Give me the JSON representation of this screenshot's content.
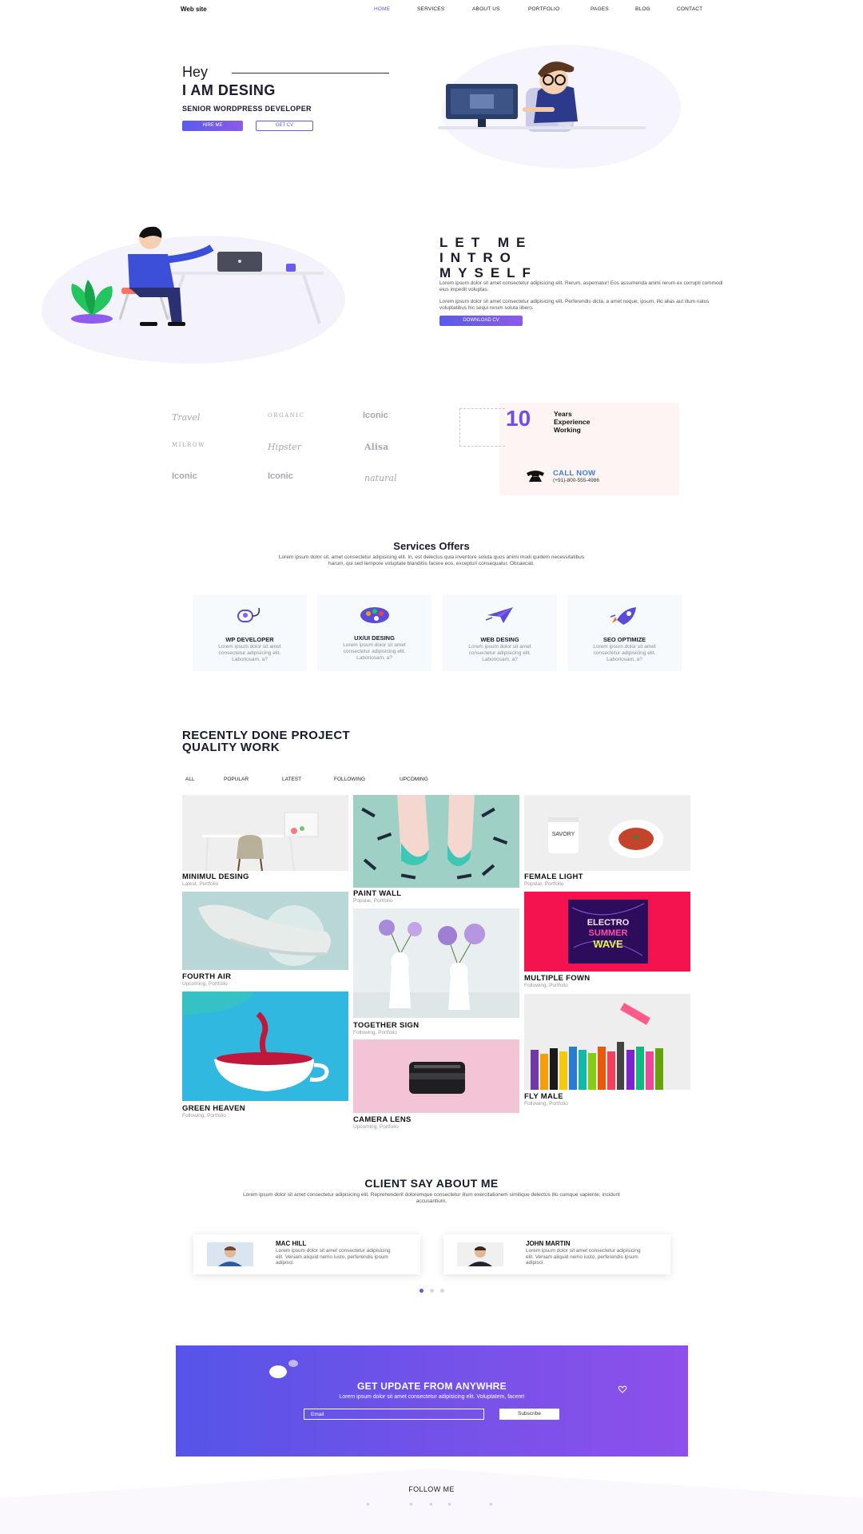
{
  "nav": {
    "logo": "Web site",
    "items": [
      "HOME",
      "SERVICES",
      "ABOUT US",
      "PORTFOLIO",
      "PAGES",
      "BLOG",
      "CONTACT"
    ]
  },
  "hero": {
    "greeting": "Hey",
    "title": "I AM DESING",
    "subtitle": "SENIOR WORDPRESS DEVELOPER",
    "hire_label": "HIRE ME",
    "cv_label": "GET CV"
  },
  "intro": {
    "title_lines": [
      "LET ME",
      "INTRO",
      "MYSELF"
    ],
    "para1": "Lorem ipsum dolor sit amet consectetur adipisicing elit. Rerum, aspernatur! Eos assumenda animi rerum ex corrupti commodi eius impedit voluptas.",
    "para2": "Lorem ipsum dolor sit amet consectetur adipisicing elit. Perferendis dicta, a amet neque, ipsum, illo alias aut illum natus voluptatibus hic sequi rerum soluta libero.",
    "download_label": "DOWNLOAD CV"
  },
  "brands": [
    "Travel",
    "ORGANIC",
    "Iconic",
    "MILROW",
    "Hipster",
    "Alisa",
    "Iconic",
    "Iconic",
    "natural"
  ],
  "experience": {
    "number": "10",
    "label_lines": [
      "Years",
      "Experience",
      "Working"
    ],
    "call_label": "CALL NOW",
    "phone": "(+91)-800-555-4986"
  },
  "services": {
    "title": "Services Offers",
    "description": "Lorem ipsum dolor sit, amet consectetur adipisicing elit. In, est delectus quia inventore soluta quos animi modi quidem necessitatibus harum, qui sed tempore voluptate blanditiis facere eos, excepturi consequatur. Obcaecati.",
    "cards": [
      {
        "name": "WP DEVELOPER",
        "desc": "Lorem ipsum dolor sit amet consectetur adipisicing elit. Laboriosam, a?",
        "icon": "mouse-icon"
      },
      {
        "name": "UX/UI DESING",
        "desc": "Lorem ipsum dolor sit amet consectetur adipisicing elit. Laboriosam, a?",
        "icon": "palette-icon"
      },
      {
        "name": "WEB DESING",
        "desc": "Lorem ipsum dolor sit amet consectetur adipisicing elit. Laboriosam, a?",
        "icon": "paper-plane-icon"
      },
      {
        "name": "SEO OPTIMIZE",
        "desc": "Lorem ipsum dolor sit amet consectetur adipisicing elit. Laboriosam, a?",
        "icon": "rocket-icon"
      }
    ]
  },
  "portfolio": {
    "heading_lines": [
      "RECENTLY DONE PROJECT",
      "QUALITY WORK"
    ],
    "filters": [
      "ALL",
      "POPULAR",
      "LATEST",
      "FOLLOWING",
      "UPCOMING"
    ],
    "tiles": [
      {
        "title": "MINIMUL DESING",
        "sub": "Latest, Portfolio"
      },
      {
        "title": "PAINT WALL",
        "sub": "Popular, Portfolio"
      },
      {
        "title": "FEMALE LIGHT",
        "sub": "Popular, Portfolio"
      },
      {
        "title": "FOURTH AIR",
        "sub": "Upcoming, Portfolio"
      },
      {
        "title": "TOGETHER SIGN",
        "sub": "Following, Portfolio"
      },
      {
        "title": "MULTIPLE FOWN",
        "sub": "Following, Portfolio"
      },
      {
        "title": "GREEN HEAVEN",
        "sub": "Following, Portfolio"
      },
      {
        "title": "CAMERA LENS",
        "sub": "Upcoming, Portfolio"
      },
      {
        "title": "FLY MALE",
        "sub": "Following, Portfolio"
      }
    ],
    "image_texts": {
      "savory": "SAVORY",
      "electro": "ELECTRO",
      "summer": "SUMMER",
      "wave": "WAVE"
    }
  },
  "testimonials": {
    "title": "CLIENT SAY ABOUT ME",
    "description": "Lorem ipsum dolor sit amet consectetur adipisicing elit. Reprehenderit doloremque consectetur illum exercitationem similique delectus illo cumque sapiente, incidunt accusantium.",
    "items": [
      {
        "name": "MAC HILL",
        "text": "Lorem ipsum dolor sit amet consectetur adipisicing elit. Veniam aliquid nemo iusto, perferendis ipsum adipisci."
      },
      {
        "name": "JOHN MARTIN",
        "text": "Lorem ipsum dolor sit amet consectetur adipisicing elit. Veniam aliquid nemo iusto, perferendis ipsum adipisci."
      }
    ]
  },
  "newsletter": {
    "title": "GET UPDATE FROM ANYWHRE",
    "subtitle": "Lorem ipsum dolor sit amet consectetur adipisicing elit. Voluptatem, facere!",
    "email_placeholder": "Email",
    "subscribe_label": "Subscribe"
  },
  "footer": {
    "follow": "FOLLOW ME",
    "social_icons": [
      "facebook-icon",
      "twitter-icon",
      "instagram-icon",
      "youtube-icon",
      "vimeo-icon"
    ]
  },
  "colors": {
    "accent": "#5a5bea",
    "accent2": "#8b5be8",
    "call": "#3f7de6",
    "experience_number": "#6f4cf0"
  }
}
